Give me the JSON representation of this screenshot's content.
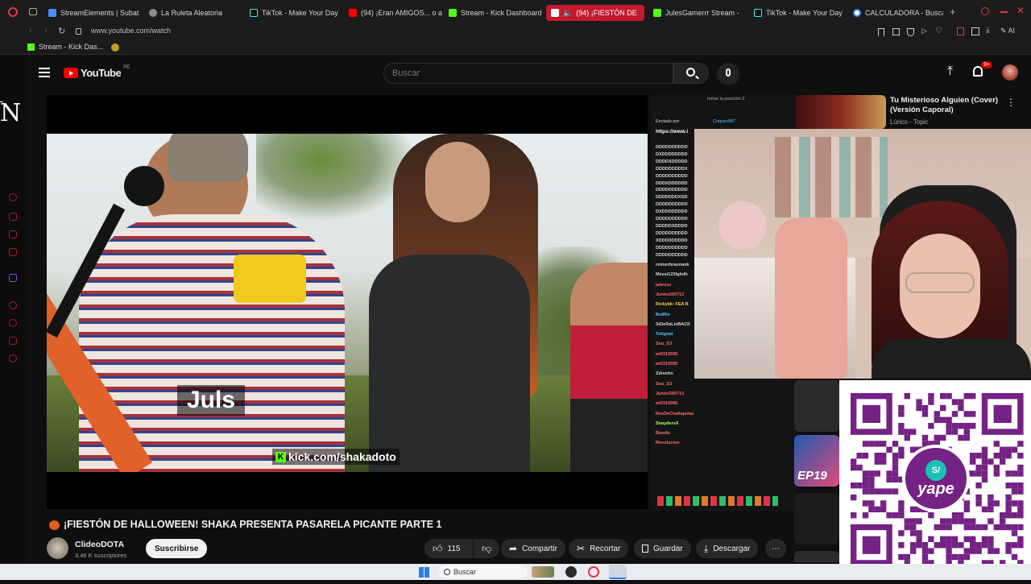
{
  "browser": {
    "tabs": [
      {
        "label": "StreamElements | Subat",
        "color": "#4a8cff"
      },
      {
        "label": "La Ruleta Aleatoria",
        "color": "#8b8b8b"
      },
      {
        "label": "TikTok - Make Your Day",
        "color": "#111111"
      },
      {
        "label": "(94) ¡Eran AMIGOS... o a",
        "color": "#ff0000"
      },
      {
        "label": "Stream - Kick Dashboard",
        "color": "#53fc18"
      },
      {
        "label": "(94) ¡FIESTÓN DE",
        "color": "#ff0000",
        "active": true
      },
      {
        "label": "JulesGamerrr Stream -",
        "color": "#53fc18"
      },
      {
        "label": "TikTok - Make Your Day",
        "color": "#111111"
      },
      {
        "label": "CALCULADORA - Buscar",
        "color": "#4285f4"
      }
    ],
    "url": "www.youtube.com/watch",
    "bookmark": "Stream - Kick Das...",
    "ai_label": "AI"
  },
  "youtube": {
    "logo_text": "YouTube",
    "region": "PE",
    "search_placeholder": "Buscar",
    "notification_count": "9+"
  },
  "video": {
    "caption_name": "Juls",
    "kick_url": "kick.com/shakadoto",
    "title": "¡FIESTÓN DE HALLOWEEN! SHAKA PRESENTA PASARELA PICANTE PARTE 1",
    "channel": "ClideoDOTA",
    "subscribers": "3.46 K suscriptores",
    "subscribe_label": "Suscribirse",
    "likes": "115",
    "share_label": "Compartir",
    "clip_label": "Recortar",
    "save_label": "Guardar",
    "download_label": "Descargar"
  },
  "recommendation": {
    "title_line1": "Tu Misterioso Alguien (Cover)",
    "title_line2": "(Versión Caporal)",
    "channel": "Lúrico - Topic"
  },
  "chat": {
    "top_line": "tomar la posición 3",
    "sent_by": "Enviado por",
    "sender": "Coques987",
    "link": "https://www.i",
    "spam": [
      "DDDDDDDDDD",
      "DXDDDDDDDD",
      "DDDDXDDDDD",
      "DDDDDDDDDX",
      "DDDDDDDDDD",
      "DDDXDDDDDD",
      "DDDDDDDDDD",
      "DDDDDDDXDD",
      "DDDDDDDDDD",
      "DXDDDDDDDD",
      "DDDDDDDDDD",
      "DDDDDXDDDD",
      "DDDDDDDDDD",
      "XDDDDDDDDD",
      "DDDDDDDDDD",
      "DDDDDDDDDD"
    ],
    "users": [
      "reimerbraunank",
      "Messi123fghdh",
      "jabrosz",
      "Junior200712",
      "Rickybk: FEA B",
      "BotRix",
      "SiDeRaLisBACK",
      "Totigoat",
      "Sou_DJ",
      "will310595",
      "will310595",
      "Zdreehn",
      "Sou_DJ",
      "Junior200712",
      "will310595",
      "RevDeChallapelaz",
      "SnaydersX",
      "Bendiz",
      "Revolucion"
    ]
  },
  "overlay": {
    "qr_brand": "yape"
  },
  "taskbar": {
    "search_placeholder": "Buscar"
  },
  "colors": {
    "accent": "#c21a2f",
    "kick_green": "#53fc18",
    "yape_purple": "#742284"
  }
}
